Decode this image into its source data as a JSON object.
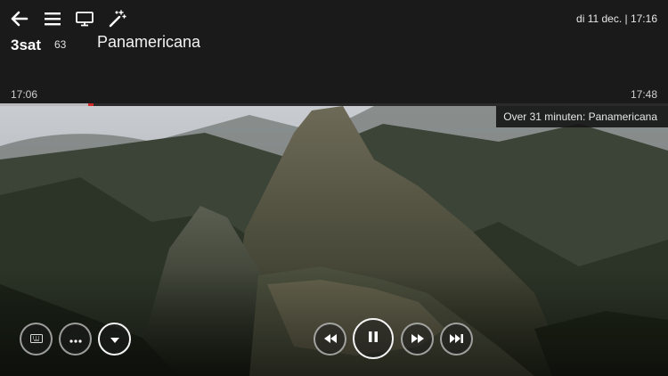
{
  "header": {
    "datetime": "di 11 dec. | 17:16",
    "icons": [
      "back-arrow-icon",
      "menu-icon",
      "tv-icon",
      "magic-wand-icon"
    ]
  },
  "channel": {
    "logo_text": "3sat",
    "number": "63"
  },
  "program": {
    "title": "Panamericana",
    "start_time": "17:06",
    "end_time": "17:48",
    "progress": 0.14
  },
  "up_next": {
    "label": "Over 31 minuten: Panamericana"
  },
  "controls": {
    "left": [
      "keyboard-icon",
      "more-icon",
      "dropdown-icon"
    ],
    "playback": [
      "rewind-icon",
      "pause-icon",
      "fast-forward-icon",
      "skip-icon"
    ]
  },
  "colors": {
    "panel": "#1a1a1b",
    "progress": "#b8b8b8",
    "progress_head": "#d02a2a"
  }
}
